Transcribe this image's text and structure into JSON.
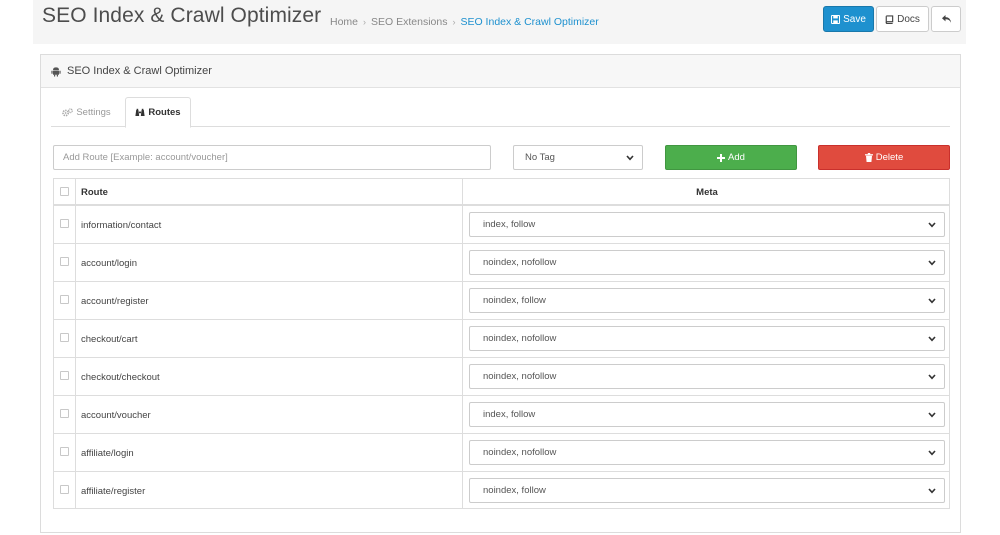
{
  "header": {
    "title": "SEO Index & Crawl Optimizer",
    "breadcrumbs": [
      {
        "label": "Home"
      },
      {
        "label": "SEO Extensions"
      },
      {
        "label": "SEO Index & Crawl Optimizer"
      }
    ],
    "save_label": "Save",
    "docs_label": "Docs"
  },
  "panel": {
    "title": "SEO Index & Crawl Optimizer"
  },
  "tabs": [
    {
      "label": "Settings"
    },
    {
      "label": "Routes"
    }
  ],
  "toolbar": {
    "route_placeholder": "Add Route [Example: account/voucher]",
    "tag_value": "No Tag",
    "add_label": "Add",
    "delete_label": "Delete"
  },
  "table": {
    "headers": {
      "route": "Route",
      "meta": "Meta"
    },
    "rows": [
      {
        "route": "information/contact",
        "meta": "index, follow"
      },
      {
        "route": "account/login",
        "meta": "noindex, nofollow"
      },
      {
        "route": "account/register",
        "meta": "noindex, follow"
      },
      {
        "route": "checkout/cart",
        "meta": "noindex, nofollow"
      },
      {
        "route": "checkout/checkout",
        "meta": "noindex, nofollow"
      },
      {
        "route": "account/voucher",
        "meta": "index, follow"
      },
      {
        "route": "affiliate/login",
        "meta": "noindex, nofollow"
      },
      {
        "route": "affiliate/register",
        "meta": "noindex, follow"
      }
    ]
  },
  "colors": {
    "primary": "#1e91cf",
    "success": "#4cae4c",
    "danger": "#e04b3e"
  },
  "icons": [
    "save-icon",
    "book-icon",
    "reply-icon",
    "android-icon",
    "cogs-icon",
    "binoculars-icon",
    "plus-icon",
    "trash-icon",
    "chevron-down-icon"
  ]
}
